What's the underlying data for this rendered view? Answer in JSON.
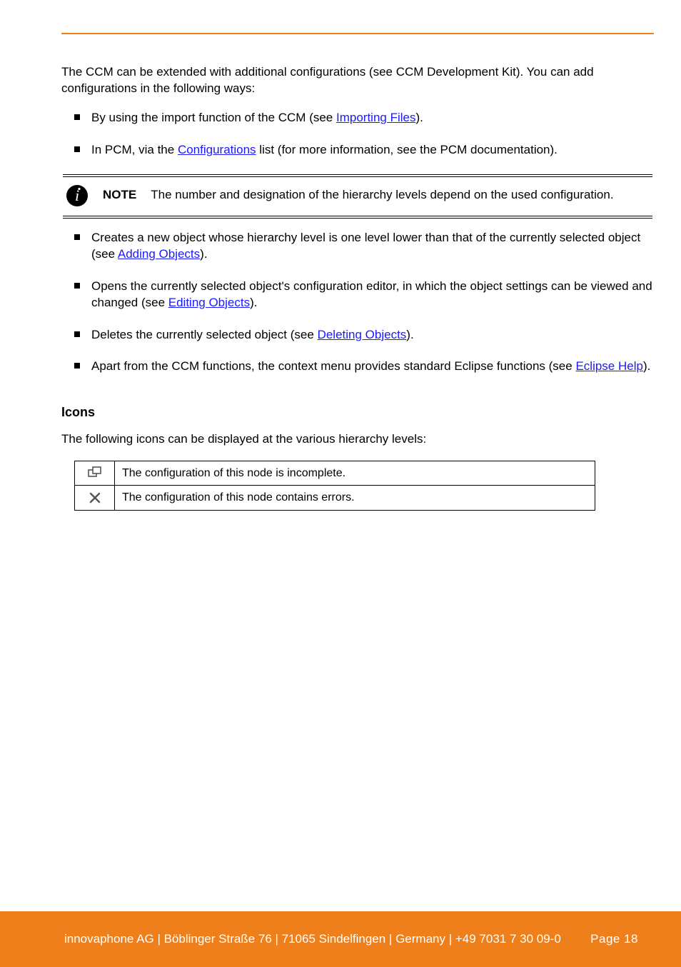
{
  "intro": "The CCM can be extended with additional configurations (see CCM Development Kit). You can add configurations in the following ways:",
  "bullet1": {
    "pre": "By using the import function of the CCM (see ",
    "link": "Importing Files",
    "post": ")."
  },
  "bullet2": {
    "pre": "In PCM, via the ",
    "link": "Configurations",
    "post": " list (for more information, see the PCM documentation)."
  },
  "note": {
    "label": "NOTE",
    "text": "The number and designation of the hierarchy levels depend on the used configuration."
  },
  "bullet3": {
    "pre": "Creates a new object whose hierarchy level is one level lower than that of the currently selected object (see ",
    "link": "Adding Objects",
    "post": ")."
  },
  "bullet4": {
    "pre": "Opens the currently selected object's configuration editor, in which the object settings can be viewed and changed (see ",
    "link": "Editing Objects",
    "post": ")."
  },
  "bullet5": {
    "pre": "Deletes the currently selected object (see ",
    "link": "Deleting Objects",
    "post": ")."
  },
  "bullet6": {
    "pre": "Apart from the CCM functions, the context menu provides standard Eclipse functions (see ",
    "link": "Eclipse Help",
    "post": ")."
  },
  "section": {
    "icons_title": "Icons",
    "icons_body": "The following icons can be displayed at the various hierarchy levels:",
    "table": {
      "row1": "The configuration of this node is incomplete.",
      "row2": "The configuration of this node contains errors."
    }
  },
  "footer": {
    "left": "innovaphone AG | Böblinger Straße 76 | 71065 Sindelfingen | Germany | +49 7031 7 30 09-0",
    "right": "Page 18"
  }
}
